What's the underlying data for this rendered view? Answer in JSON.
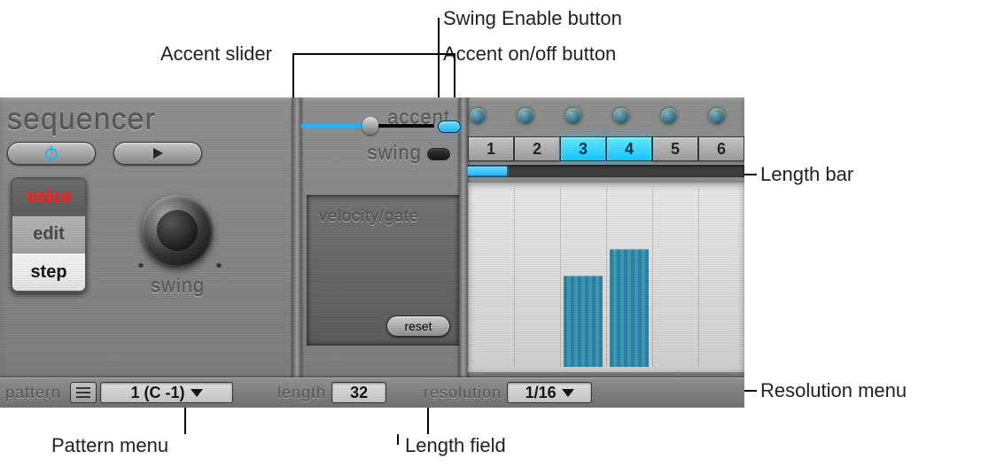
{
  "callouts": {
    "swing_enable": "Swing Enable button",
    "accent_slider": "Accent slider",
    "accent_toggle": "Accent on/off button",
    "length_bar": "Length bar",
    "resolution_menu": "Resolution menu",
    "length_field": "Length field",
    "pattern_menu": "Pattern menu"
  },
  "title": "sequencer",
  "rocker": {
    "voice": "voice",
    "edit": "edit",
    "step": "step"
  },
  "swing_label": "swing",
  "accent": {
    "label": "accent",
    "value_pct": 52,
    "on": true
  },
  "swing_row": {
    "label": "swing",
    "on": false
  },
  "steps": {
    "count": 6,
    "labels": [
      "1",
      "2",
      "3",
      "4",
      "5",
      "6"
    ],
    "active": [
      false,
      false,
      true,
      true,
      false,
      false
    ]
  },
  "length_bar_pct": 14,
  "velocity_gate": {
    "title": "velocity/gate",
    "reset": "reset",
    "bars": [
      {
        "step": 3,
        "height_pct": 48
      },
      {
        "step": 4,
        "height_pct": 62
      }
    ]
  },
  "bottom": {
    "pattern_label": "pattern",
    "pattern_value": "1 (C -1)",
    "length_label": "length",
    "length_value": "32",
    "resolution_label": "resolution",
    "resolution_value": "1/16"
  }
}
